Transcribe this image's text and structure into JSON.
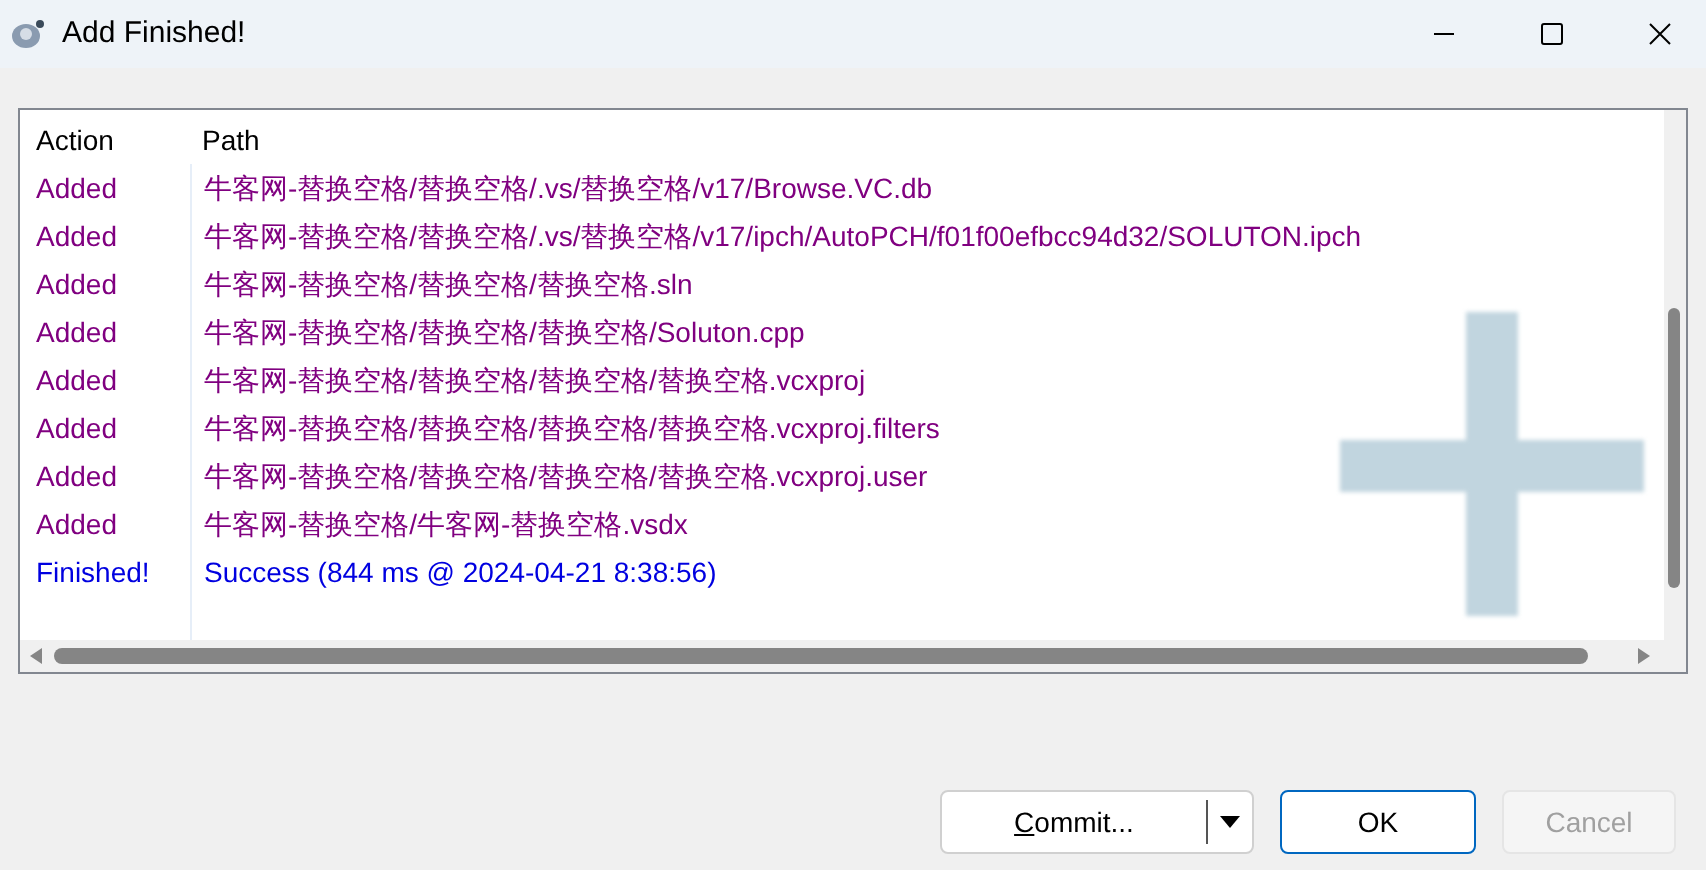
{
  "window": {
    "title": "Add Finished!"
  },
  "table": {
    "columns": [
      "Action",
      "Path"
    ],
    "rows": [
      {
        "kind": "added",
        "action": "Added",
        "path": "牛客网-替换空格/替换空格/.vs/替换空格/v17/Browse.VC.db"
      },
      {
        "kind": "added",
        "action": "Added",
        "path": "牛客网-替换空格/替换空格/.vs/替换空格/v17/ipch/AutoPCH/f01f00efbcc94d32/SOLUTON.ipch"
      },
      {
        "kind": "added",
        "action": "Added",
        "path": "牛客网-替换空格/替换空格/替换空格.sln"
      },
      {
        "kind": "added",
        "action": "Added",
        "path": "牛客网-替换空格/替换空格/替换空格/Soluton.cpp"
      },
      {
        "kind": "added",
        "action": "Added",
        "path": "牛客网-替换空格/替换空格/替换空格/替换空格.vcxproj"
      },
      {
        "kind": "added",
        "action": "Added",
        "path": "牛客网-替换空格/替换空格/替换空格/替换空格.vcxproj.filters"
      },
      {
        "kind": "added",
        "action": "Added",
        "path": "牛客网-替换空格/替换空格/替换空格/替换空格.vcxproj.user"
      },
      {
        "kind": "added",
        "action": "Added",
        "path": "牛客网-替换空格/牛客网-替换空格.vsdx"
      },
      {
        "kind": "finished",
        "action": "Finished!",
        "path": "Success (844 ms @ 2024-04-21 8:38:56)"
      }
    ]
  },
  "buttons": [
    {
      "label": "Commit...",
      "kind": "split",
      "disabled": false,
      "default": false
    },
    {
      "label": "OK",
      "kind": "plain",
      "disabled": false,
      "default": true
    },
    {
      "label": "Cancel",
      "kind": "plain",
      "disabled": true,
      "default": false
    }
  ]
}
